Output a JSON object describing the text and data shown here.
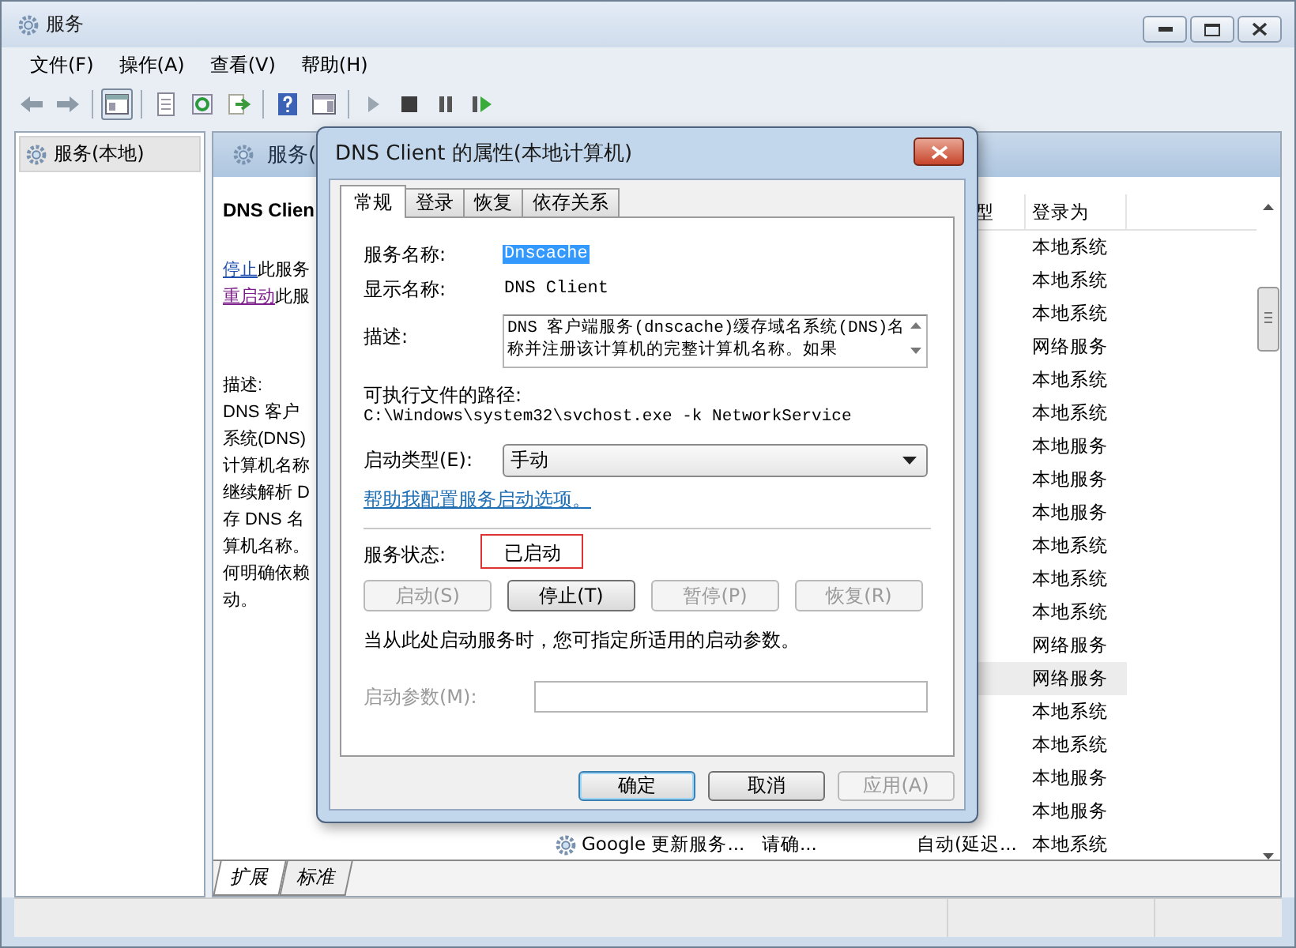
{
  "window": {
    "title": "服务"
  },
  "menu": [
    "文件(F)",
    "操作(A)",
    "查看(V)",
    "帮助(H)"
  ],
  "toolbar": [
    {
      "kind": "back",
      "pressed": false
    },
    {
      "kind": "forward",
      "pressed": false
    },
    {
      "kind": "sep"
    },
    {
      "kind": "tree",
      "pressed": true
    },
    {
      "kind": "sep"
    },
    {
      "kind": "properties",
      "pressed": false
    },
    {
      "kind": "refresh",
      "pressed": false
    },
    {
      "kind": "export",
      "pressed": false
    },
    {
      "kind": "sep"
    },
    {
      "kind": "help",
      "pressed": false
    },
    {
      "kind": "view",
      "pressed": false
    },
    {
      "kind": "sep"
    },
    {
      "kind": "play",
      "pressed": false
    },
    {
      "kind": "stop",
      "pressed": false
    },
    {
      "kind": "pause",
      "pressed": false
    },
    {
      "kind": "resume",
      "pressed": false
    }
  ],
  "tree": [
    {
      "label": "服务(本地)",
      "selected": true
    }
  ],
  "panel": {
    "title": "服务(",
    "service": "DNS Clien",
    "links": [
      {
        "link": "停止",
        "rest": "此服务",
        "visited": false
      },
      {
        "link": "重启动",
        "rest": "此服",
        "visited": true
      }
    ],
    "description": [
      "描述:",
      "DNS 客户",
      "系统(DNS)",
      "计算机名称",
      "继续解析 D",
      "存 DNS 名",
      "算机名称。",
      "何明确依赖",
      "动。"
    ]
  },
  "list": {
    "columns": {
      "startup": "型",
      "logon": "登录为"
    },
    "rows": [
      {
        "logon": "本地系统",
        "selected": false
      },
      {
        "logon": "本地系统",
        "selected": false
      },
      {
        "logon": "本地系统",
        "selected": false
      },
      {
        "logon": "网络服务",
        "selected": false
      },
      {
        "logon": "本地系统",
        "selected": false
      },
      {
        "logon": "本地系统",
        "selected": false
      },
      {
        "logon": "本地服务",
        "selected": false
      },
      {
        "logon": "本地服务",
        "selected": false
      },
      {
        "logon": "本地服务",
        "selected": false
      },
      {
        "logon": "本地系统",
        "selected": false
      },
      {
        "logon": "本地系统",
        "selected": false
      },
      {
        "logon": "本地系统",
        "selected": false
      },
      {
        "logon": "网络服务",
        "selected": false
      },
      {
        "logon": "网络服务",
        "selected": true
      },
      {
        "logon": "本地系统",
        "selected": false
      },
      {
        "logon": "本地系统",
        "selected": false
      },
      {
        "logon": "本地服务",
        "selected": false
      },
      {
        "logon": "本地服务",
        "selected": false
      },
      {
        "name": "Google 更新服务...",
        "description": "请确...",
        "startup": "自动(延迟...",
        "logon": "本地系统",
        "selected": false
      }
    ]
  },
  "view_tabs": [
    {
      "label": "扩展",
      "selected": true
    },
    {
      "label": "标准",
      "selected": false
    }
  ],
  "dialog": {
    "title": "DNS Client 的属性(本地计算机)",
    "tabs": [
      {
        "label": "常规",
        "selected": true
      },
      {
        "label": "登录",
        "selected": false
      },
      {
        "label": "恢复",
        "selected": false
      },
      {
        "label": "依存关系",
        "selected": false
      }
    ],
    "service_name": {
      "label": "服务名称:",
      "value": "Dnscache",
      "selected": true
    },
    "display_name": {
      "label": "显示名称:",
      "value": "DNS Client"
    },
    "description": {
      "label": "描述:",
      "value": "DNS 客户端服务(dnscache)缓存域名系统(DNS)名称并注册该计算机的完整计算机名称。如果"
    },
    "path": {
      "label": "可执行文件的路径:",
      "value": "C:\\Windows\\system32\\svchost.exe -k NetworkService"
    },
    "startup_type": {
      "label": "启动类型(E):",
      "value": "手动"
    },
    "help_link": "帮助我配置服务启动选项。",
    "status": {
      "label": "服务状态:",
      "value": "已启动",
      "annotated": true
    },
    "service_buttons": [
      {
        "label": "启动(S)",
        "disabled": true
      },
      {
        "label": "停止(T)",
        "disabled": false
      },
      {
        "label": "暂停(P)",
        "disabled": true
      },
      {
        "label": "恢复(R)",
        "disabled": true
      }
    ],
    "hint": "当从此处启动服务时，您可指定所适用的启动参数。",
    "params": {
      "label": "启动参数(M):",
      "disabled": true
    },
    "buttons": [
      {
        "label": "确定",
        "disabled": false,
        "default": true
      },
      {
        "label": "取消",
        "disabled": false,
        "default": false
      },
      {
        "label": "应用(A)",
        "disabled": true,
        "default": false
      }
    ]
  }
}
